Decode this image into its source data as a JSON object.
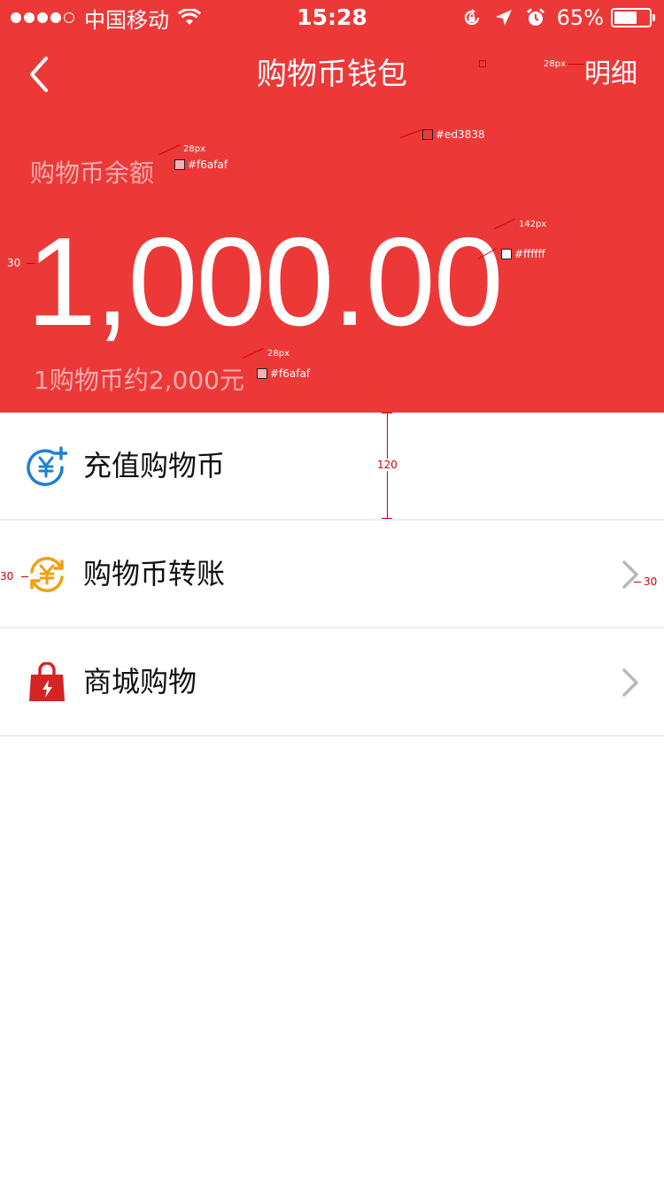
{
  "status_bar": {
    "carrier": "中国移动",
    "time": "15:28",
    "battery_percent": "65%",
    "battery_level": 0.65,
    "signal_bars_filled": 4,
    "signal_bars_total": 5
  },
  "nav": {
    "title": "购物币钱包",
    "right_link": "明细"
  },
  "wallet": {
    "balance_label": "购物币余额",
    "balance_amount": "1,000.00",
    "rate_note": "1购物币约2,000元"
  },
  "menu": {
    "items": [
      {
        "label": "充值购物币",
        "icon": "yen-plus-icon",
        "has_chevron": false
      },
      {
        "label": "购物币转账",
        "icon": "yen-transfer-icon",
        "has_chevron": true
      },
      {
        "label": "商城购物",
        "icon": "shopping-bag-icon",
        "has_chevron": true
      }
    ]
  },
  "annotations": {
    "nav_font_size": "28px",
    "bg_color_code": "#ed3838",
    "label_font_size": "28px",
    "label_color_code": "#f6afaf",
    "amount_font_size": "142px",
    "amount_color_code": "#ffffff",
    "note_font_size": "28px",
    "note_color_code": "#f6afaf",
    "left_margin": "30",
    "row_height": "120",
    "row_left_margin": "30",
    "row_right_margin": "30"
  },
  "colors": {
    "header_bg": "#ed3838",
    "muted_text": "#f6afaf",
    "white": "#ffffff",
    "blue_icon": "#1f7fd6",
    "orange_icon": "#f0a010",
    "red_icon": "#d42424",
    "chevron": "#b8b8b8"
  }
}
